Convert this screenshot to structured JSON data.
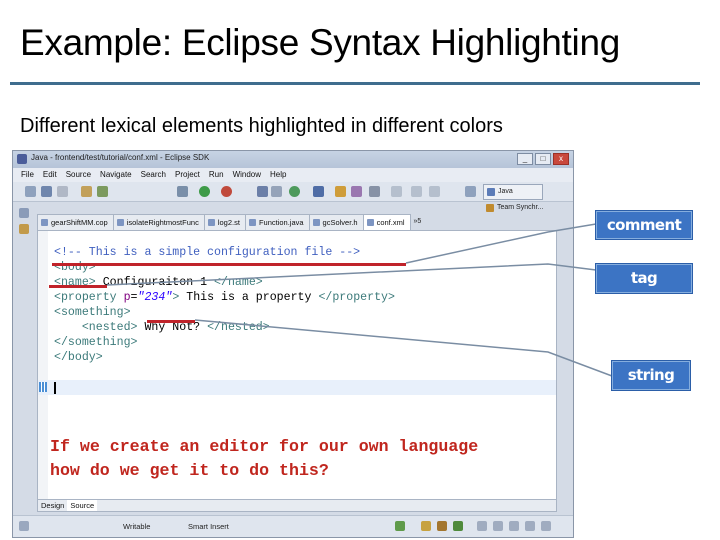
{
  "slide": {
    "title": "Example: Eclipse Syntax Highlighting",
    "subtitle": "Different lexical elements highlighted in different colors"
  },
  "window": {
    "title": "Java - frontend/test/tutorial/conf.xml - Eclipse SDK",
    "controls": [
      "_",
      "□",
      "x"
    ],
    "menu": [
      "File",
      "Edit",
      "Source",
      "Navigate",
      "Search",
      "Project",
      "Run",
      "Window",
      "Help"
    ],
    "perspective": "Java",
    "team_view": "Team Synchr...",
    "tabs": [
      {
        "label": "gearShiftMM.cop",
        "active": false
      },
      {
        "label": "isolateRightmostFunc",
        "active": false
      },
      {
        "label": "log2.st",
        "active": false
      },
      {
        "label": "Function.java",
        "active": false
      },
      {
        "label": "gcSolver.h",
        "active": false
      },
      {
        "label": "conf.xml",
        "active": true
      }
    ],
    "tabs_overflow": "»5",
    "code_lines": {
      "line1": "<!-- This is a simple configuration file -->",
      "line2": "<body>",
      "line3_tag_open": "<name>",
      "line3_text": " Configuraiton 1 ",
      "line3_tag_close": "</name>",
      "line4_tag_open": "<property ",
      "line4_attr": "p",
      "line4_eq": "=",
      "line4_string": "\"234\"",
      "line4_gt": ">",
      "line4_text": " This is a property ",
      "line4_tag_close": "</property>",
      "line5": "<something>",
      "line6_tag_open": "<nested>",
      "line6_text": " Why Not? ",
      "line6_tag_close": "</nested>",
      "line7": "</something>",
      "line8": "</body>"
    },
    "overlay_question_line1": "If we create an editor for our own language",
    "overlay_question_line2": "how do we get it to do this?",
    "bottom_tabs": [
      {
        "label": "Design",
        "active": false
      },
      {
        "label": "Source",
        "active": true
      }
    ],
    "status": {
      "writable": "Writable",
      "insert_mode": "Smart Insert"
    }
  },
  "callouts": {
    "comment": "comment",
    "tag": "tag",
    "string": "string"
  },
  "colors": {
    "title_rule": "#3f6d8e",
    "callout_fill": "#3c74c4",
    "underline_red": "#c0232a",
    "comment_blue": "#3f5fbf",
    "tag_teal": "#3c7a7a",
    "string_blue": "#2a00ff",
    "question_red": "#c0261e"
  }
}
